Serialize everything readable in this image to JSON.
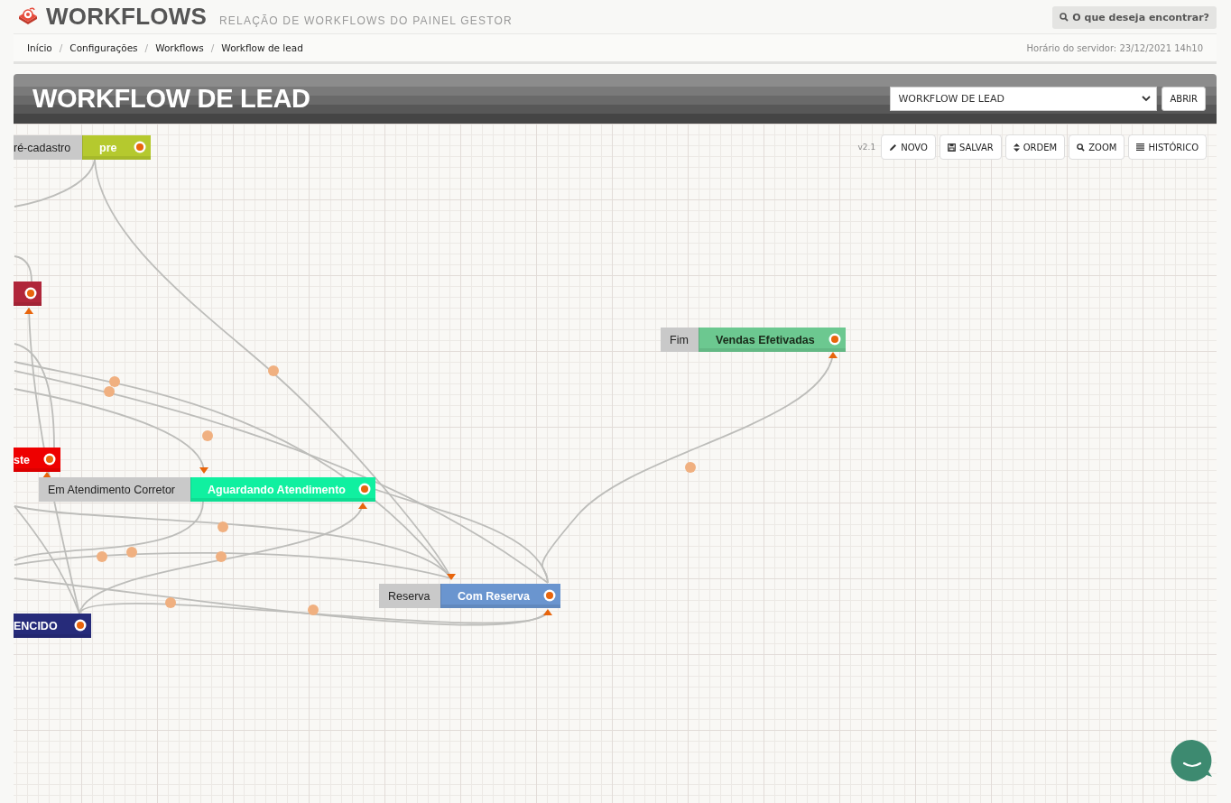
{
  "header": {
    "title": "WORKFLOWS",
    "subtitle": "RELAÇÃO DE WORKFLOWS DO PAINEL GESTOR",
    "search_button": "O que deseja encontrar?"
  },
  "breadcrumb": [
    {
      "kind": "link",
      "text": "Início"
    },
    {
      "kind": "separator",
      "text": "/"
    },
    {
      "kind": "link",
      "text": "Configurações"
    },
    {
      "kind": "separator",
      "text": "/"
    },
    {
      "kind": "link",
      "text": "Workflows"
    },
    {
      "kind": "separator",
      "text": "/"
    },
    {
      "kind": "current",
      "text": "Workflow de lead"
    }
  ],
  "server_time": "Horário do servidor: 23/12/2021 14h10",
  "panel": {
    "title": "WORKFLOW DE LEAD",
    "select": {
      "value": "WORKFLOW DE LEAD"
    },
    "open_button": "ABRIR"
  },
  "toolbar": {
    "version": "v2.1",
    "buttons": [
      "NOVO",
      "SALVAR",
      "ORDEM",
      "ZOOM",
      "HISTÓRICO"
    ]
  },
  "nodes": [
    {
      "prefix": "ré-cadastro",
      "label": "pre",
      "color": "#b5c92e",
      "dark_label": false
    },
    {
      "color": "#b0263a"
    },
    {
      "label": "ste",
      "color": "#ee0000",
      "dark_label": false
    },
    {
      "prefix": "Em Atendimento Corretor",
      "label": "Aguardando Atendimento",
      "color": "#10f0a0",
      "dark_label": false
    },
    {
      "prefix": "Fim",
      "label": "Vendas Efetivadas",
      "color": "#6cc890",
      "dark_label": true
    },
    {
      "prefix": "Reserva",
      "label": "Com Reserva",
      "color": "#6a95cf",
      "dark_label": false
    },
    {
      "label": "ENCIDO",
      "color": "#262b7a",
      "dark_label": false
    }
  ]
}
